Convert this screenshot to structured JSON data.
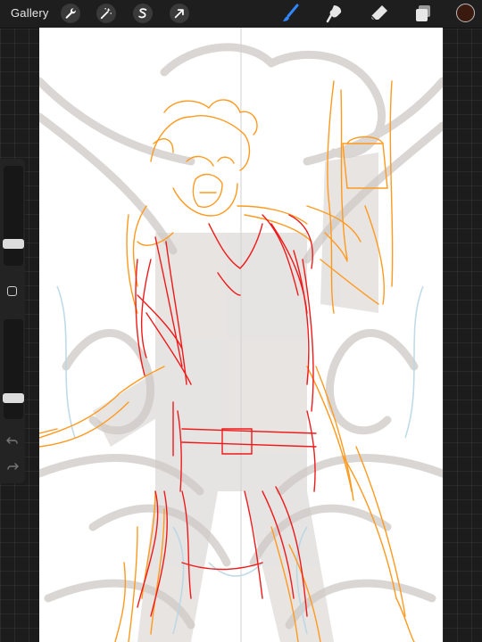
{
  "app": {
    "gallery_label": "Gallery"
  },
  "toolbar": {
    "left_tools": [
      {
        "name": "actions",
        "icon": "wrench-icon"
      },
      {
        "name": "adjustments",
        "icon": "magic-wand-icon"
      },
      {
        "name": "selection",
        "icon": "selection-s-icon"
      },
      {
        "name": "transform",
        "icon": "arrow-cursor-icon"
      }
    ],
    "right_tools": [
      {
        "name": "brush",
        "icon": "brush-icon",
        "active": true
      },
      {
        "name": "smudge",
        "icon": "smudge-icon",
        "active": false
      },
      {
        "name": "eraser",
        "icon": "eraser-icon",
        "active": false
      },
      {
        "name": "layers",
        "icon": "layers-icon",
        "active": false
      }
    ],
    "current_color": "#3a1a0e"
  },
  "colors": {
    "accent": "#2f86ff",
    "sketch_orange": "#ff9a1f",
    "sketch_red": "#ee1a1a",
    "guide_gray": "#bdb6b0",
    "guide_blue": "#b9d7e6"
  }
}
